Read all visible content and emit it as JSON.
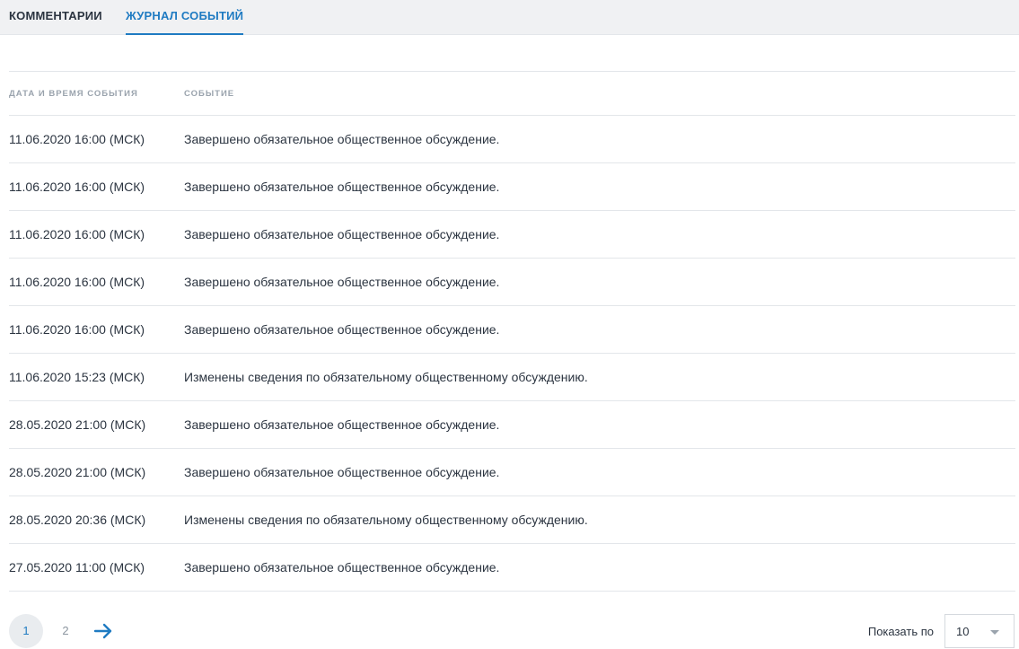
{
  "tabs": [
    {
      "label": "КОММЕНТАРИИ",
      "active": false
    },
    {
      "label": "ЖУРНАЛ СОБЫТИЙ",
      "active": true
    }
  ],
  "table": {
    "columns": [
      "ДАТА И ВРЕМЯ СОБЫТИЯ",
      "СОБЫТИЕ"
    ],
    "rows": [
      {
        "date": "11.06.2020 16:00 (МСК)",
        "event": "Завершено обязательное общественное обсуждение."
      },
      {
        "date": "11.06.2020 16:00 (МСК)",
        "event": "Завершено обязательное общественное обсуждение."
      },
      {
        "date": "11.06.2020 16:00 (МСК)",
        "event": "Завершено обязательное общественное обсуждение."
      },
      {
        "date": "11.06.2020 16:00 (МСК)",
        "event": "Завершено обязательное общественное обсуждение."
      },
      {
        "date": "11.06.2020 16:00 (МСК)",
        "event": "Завершено обязательное общественное обсуждение."
      },
      {
        "date": "11.06.2020 15:23 (МСК)",
        "event": "Изменены сведения по обязательному общественному обсуждению."
      },
      {
        "date": "28.05.2020 21:00 (МСК)",
        "event": "Завершено обязательное общественное обсуждение."
      },
      {
        "date": "28.05.2020 21:00 (МСК)",
        "event": "Завершено обязательное общественное обсуждение."
      },
      {
        "date": "28.05.2020 20:36 (МСК)",
        "event": "Изменены сведения по обязательному общественному обсуждению."
      },
      {
        "date": "27.05.2020 11:00 (МСК)",
        "event": "Завершено обязательное общественное обсуждение."
      }
    ]
  },
  "pagination": {
    "pages": [
      "1",
      "2"
    ],
    "current": "1",
    "next_icon": "arrow-right-icon"
  },
  "page_size": {
    "label": "Показать по",
    "value": "10",
    "icon": "chevron-down-icon"
  },
  "colors": {
    "accent": "#1f7bc2",
    "text": "#2b3440",
    "muted": "#9aa3ad",
    "divider": "#e3e6ea",
    "tabs_bg": "#f0f1f3"
  }
}
